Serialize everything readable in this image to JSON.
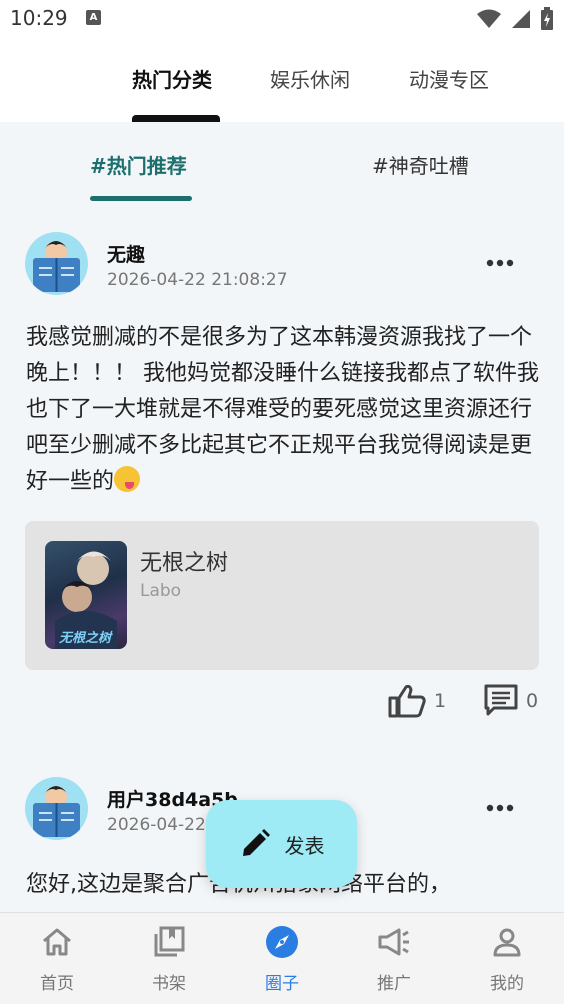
{
  "status_bar": {
    "time": "10:29",
    "notification_icon": "A"
  },
  "top_tabs": [
    {
      "label": "热门分类",
      "active": true
    },
    {
      "label": "娱乐休闲",
      "active": false
    },
    {
      "label": "动漫专区",
      "active": false
    }
  ],
  "sub_tabs": [
    {
      "label": "#热门推荐",
      "active": true
    },
    {
      "label": "#神奇吐槽",
      "active": false
    }
  ],
  "posts": [
    {
      "username": "无趣",
      "timestamp": "2026-04-22 21:08:27",
      "body": "我感觉删减的不是很多为了这本韩漫资源我找了一个晚上！！！ 我他妈觉都没睡什么链接我都点了软件我也下了一大堆就是不得难受的要死感觉这里资源还行吧至少删减不多比起其它不正规平台我觉得阅读是更好一些的",
      "book": {
        "title": "无根之树",
        "author": "Labo",
        "cover_text": "无根之树"
      },
      "likes": "1",
      "comments": "0"
    },
    {
      "username": "用户38d4a5b",
      "timestamp": "2026-04-22",
      "body": "您好,这边是聚合广告杭州猎象网络平台的，"
    }
  ],
  "fab": {
    "label": "发表"
  },
  "bottom_nav": [
    {
      "label": "首页",
      "icon": "home-icon",
      "active": false
    },
    {
      "label": "书架",
      "icon": "bookshelf-icon",
      "active": false
    },
    {
      "label": "圈子",
      "icon": "compass-icon",
      "active": true
    },
    {
      "label": "推广",
      "icon": "megaphone-icon",
      "active": false
    },
    {
      "label": "我的",
      "icon": "person-icon",
      "active": false
    }
  ],
  "colors": {
    "accent": "#1d6f6e",
    "nav_active": "#2a7de1",
    "fab_bg": "#9eeaf5"
  }
}
